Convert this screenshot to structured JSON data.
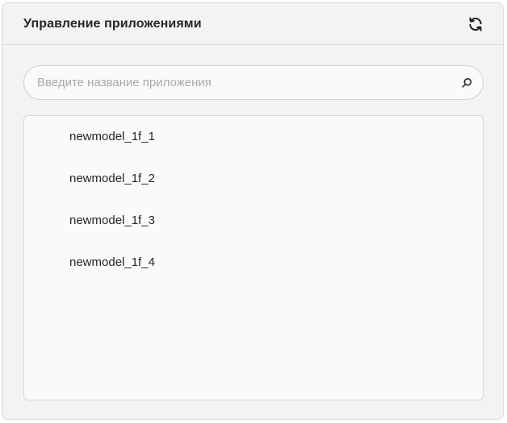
{
  "header": {
    "title": "Управление приложениями",
    "refresh_icon": "refresh-icon"
  },
  "search": {
    "placeholder": "Введите название приложения",
    "value": "",
    "icon": "search-icon"
  },
  "apps": [
    {
      "label": "newmodel_1f_1"
    },
    {
      "label": "newmodel_1f_2"
    },
    {
      "label": "newmodel_1f_3"
    },
    {
      "label": "newmodel_1f_4"
    }
  ],
  "colors": {
    "panel_bg": "#f3f3f3",
    "list_bg": "#fafafa",
    "border": "#d9d9d9",
    "text": "#262626",
    "placeholder": "#a9a9a9"
  }
}
